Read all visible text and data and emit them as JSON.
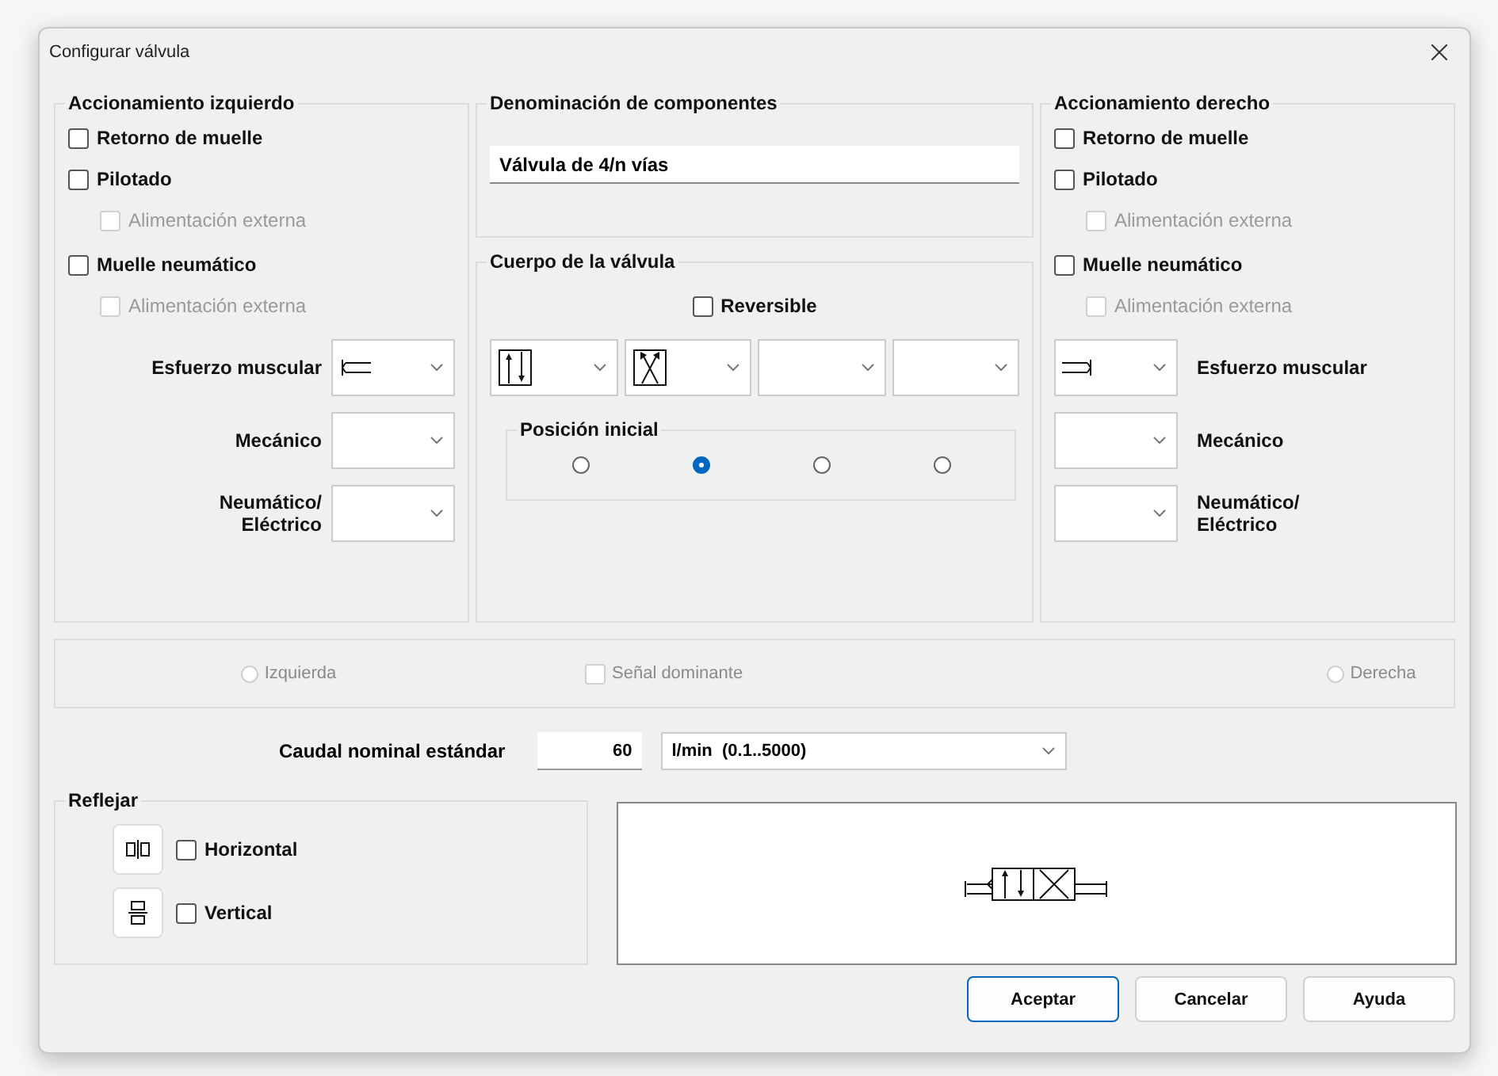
{
  "window": {
    "title": "Configurar válvula"
  },
  "left_actuation": {
    "title": "Accionamiento izquierdo",
    "options": [
      {
        "label": "Retorno de muelle",
        "checked": false,
        "disabled": false,
        "kind": "main"
      },
      {
        "label": "Pilotado",
        "checked": false,
        "disabled": false,
        "kind": "main"
      },
      {
        "label": "Alimentación externa",
        "checked": false,
        "disabled": true,
        "kind": "sub"
      },
      {
        "label": "Muelle neumático",
        "checked": false,
        "disabled": false,
        "kind": "main"
      },
      {
        "label": "Alimentación externa",
        "checked": false,
        "disabled": true,
        "kind": "sub"
      }
    ],
    "selectors": [
      {
        "label": "Esfuerzo muscular",
        "kind": "push-left"
      },
      {
        "label": "Mecánico",
        "kind": "none"
      },
      {
        "label": "Neumático/\nEléctrico",
        "kind": "none"
      }
    ]
  },
  "denomination": {
    "title": "Denominación de componentes",
    "value": "Válvula de 4/n vías"
  },
  "valve_body": {
    "title": "Cuerpo de la válvula",
    "reversible": {
      "label": "Reversible",
      "checked": false
    },
    "positions": [
      {
        "kind": "parallel"
      },
      {
        "kind": "cross"
      },
      {
        "kind": "none"
      },
      {
        "kind": "none"
      }
    ],
    "initial_position": {
      "title": "Posición inicial",
      "radios": [
        {
          "selected": false
        },
        {
          "selected": true
        },
        {
          "selected": false
        },
        {
          "selected": false
        }
      ]
    }
  },
  "right_actuation": {
    "title": "Accionamiento derecho",
    "options": [
      {
        "label": "Retorno de muelle",
        "checked": false,
        "disabled": false,
        "kind": "main"
      },
      {
        "label": "Pilotado",
        "checked": false,
        "disabled": false,
        "kind": "main"
      },
      {
        "label": "Alimentación externa",
        "checked": false,
        "disabled": true,
        "kind": "sub"
      },
      {
        "label": "Muelle neumático",
        "checked": false,
        "disabled": false,
        "kind": "main"
      },
      {
        "label": "Alimentación externa",
        "checked": false,
        "disabled": true,
        "kind": "sub"
      }
    ],
    "selectors": [
      {
        "label": "Esfuerzo muscular",
        "kind": "push-right"
      },
      {
        "label": "Mecánico",
        "kind": "none"
      },
      {
        "label": "Neumático/\nEléctrico",
        "kind": "none"
      }
    ]
  },
  "signal": [
    {
      "kind": "radio",
      "label": "Izquierda",
      "checked": false,
      "disabled": true
    },
    {
      "kind": "checkbox",
      "label": "Señal dominante",
      "checked": false,
      "disabled": true
    },
    {
      "kind": "radio",
      "label": "Derecha",
      "checked": false,
      "disabled": true
    }
  ],
  "flow": {
    "label": "Caudal nominal estándar",
    "value": "60",
    "unit": "l/min  (0.1..5000)"
  },
  "mirror": {
    "title": "Reflejar",
    "options": [
      {
        "label": "Horizontal",
        "checked": false,
        "kind": "horizontal"
      },
      {
        "label": "Vertical",
        "checked": false,
        "kind": "vertical"
      }
    ]
  },
  "buttons": [
    {
      "label": "Aceptar",
      "default": true
    },
    {
      "label": "Cancelar",
      "default": false
    },
    {
      "label": "Ayuda",
      "default": false
    }
  ]
}
